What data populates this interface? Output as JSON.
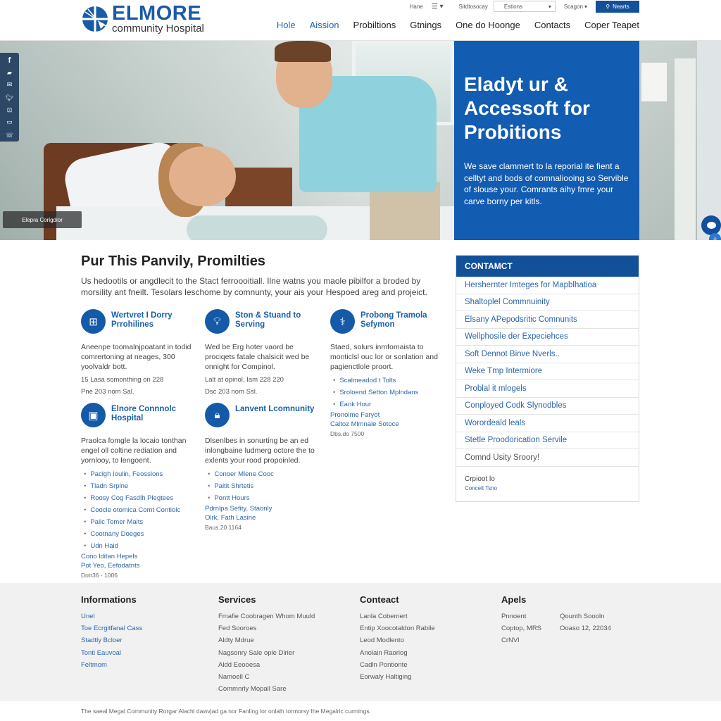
{
  "header": {
    "logo": {
      "name": "ELMORE",
      "subtitle": "community Hospital",
      "icon": "hospital-logo-icon"
    },
    "utility": {
      "home_label": "Hane",
      "menu_icon": "hamburger-icon",
      "directory_label": "Sitdtosocay",
      "select_value": "Estions",
      "signin_label": "Scagon",
      "search_label": "Nearts",
      "search_icon": "search-icon"
    },
    "nav": [
      {
        "label": "Hole",
        "active": true
      },
      {
        "label": "Aission",
        "active": true
      },
      {
        "label": "Probiltions",
        "active": false
      },
      {
        "label": "Gtnings",
        "active": false
      },
      {
        "label": "One do Hoonge",
        "active": false
      },
      {
        "label": "Contacts",
        "active": false
      },
      {
        "label": "Coper Teapet",
        "active": false
      }
    ]
  },
  "hero": {
    "social_icons": [
      "facebook-icon",
      "share-icon",
      "email-icon",
      "twitter-icon",
      "link-icon",
      "video-icon",
      "phone-icon"
    ],
    "caption": "Elepra Corigdior",
    "title": "Eladyt ur & Accessoft for Probitions",
    "text": "We save clammert to la reporial ite fient a celltyt and bods of comnaliooing so Servible of slouse your. Comrants aihy fmre your carve borny per kitls.",
    "chat_icon": "chat-icon",
    "plus_icon": "plus-icon",
    "accent_color": "#125cb2"
  },
  "main": {
    "title": "Pur This Panvily, Promilties",
    "intro": "Us hedootils or angdlecit to the Stact ferroooitiall. Ilne watns you maole pibilfor a broded by morsility ant fneilt. Tesolars leschome by comnunty, your ais your Hespoed areg and projeict.",
    "features": [
      {
        "icon": "window-icon",
        "title": "Wertvret I Dorry Prrohilines",
        "desc": "Aneenpe toomalnjpoatant in todid comrertoning at neages, 300 yoolvaldr bott.",
        "meta": [
          "15 Lasa somonthing on 228",
          "Pne 203 nom Sal."
        ]
      },
      {
        "icon": "lightbulb-icon",
        "title": "Ston & Stuand to Serving",
        "desc": "Wed be Erg hoter vaord be prociqets fatale chalsicit wed be onnight for Compinol.",
        "meta": [
          "Lalt at opinol, Iam 228 220",
          "Dsc 203 nom Ssl."
        ]
      },
      {
        "icon": "stethoscope-icon",
        "title": "Probong Tramola Sefymon",
        "desc": "Staed, solurs inmfomaista to monticlsl ouc lor or sonlation and pagienctlole proort.",
        "list": [
          "Scalmeadod t Tolts",
          "Sroloend Setton Mplndans",
          "Eank Hour"
        ],
        "links": [
          "Pronolme Faryot",
          "Caltoz Mlmnale Sotoce"
        ],
        "foot": "Dbs.do 7500"
      },
      {
        "icon": "monitor-icon",
        "title": "Elnore Connnolc Hospital",
        "desc": "Praolca fomgle la locaio tonthan engel oll coltine rediation and yornlooy, to lengoent.",
        "list": [
          "Paclgh Ioulin, Feosslons",
          "Tladn Srplne",
          "Roosy Cog Fasdlh Plegtees",
          "Coocle otomica Comt Contiolc",
          "Palic Tomer Maits",
          "Cootnany Doeges",
          "Udn Haid"
        ],
        "links": [
          "Cono lditan Hepels",
          "Pot Yeo, Eefodatnts"
        ],
        "foot": "Dotr36 - 1006"
      },
      {
        "icon": "lock-icon",
        "title": "Lanvent Lcomnunity",
        "desc": "Dlsenlbes in sonurting be an ed inlongbaine ludmerg octore the to exlents your rood propoinled.",
        "list": [
          "Conoer Mlene Cooc",
          "Paltit Shrtetis",
          "Pontt Hours"
        ],
        "links": [
          "Pdrnlpa Sefity, Staonly",
          "Olrk, Fath Lasine"
        ],
        "foot": "Baus.20 1164"
      }
    ]
  },
  "sidebar": {
    "header": "CONTAMCT",
    "items": [
      "Hershernter Imteges for Mapblhatioa",
      "Shaltoplel Commnuinity",
      "Elsany APepodsritic Comnunits",
      "Wellphosile der Expeciehces",
      "Soft Dennot Binve Nverls..",
      "Weke Tmp Intermiore",
      "Problal it mlogels",
      "Conployed Codk Slynodbles",
      "Worordeald leals",
      "Stetle Proodorication Servile",
      "Comnd Usity Sroory!"
    ],
    "footer_label": "Crpioot lo",
    "footer_link": "Concelt Tsno"
  },
  "footer": {
    "columns": [
      {
        "title": "Informations",
        "links": [
          "Unel",
          "Toe Ecrgitfanal Cass",
          "Stadtly Bcloer",
          "Tonti Eauvoal",
          "Feltmom"
        ],
        "blue": true
      },
      {
        "title": "Services",
        "links": [
          "Fmafie Coobragen Whom Muuld",
          "Fed Sooroes",
          "Aldty Mdrue",
          "Nagsonry Sale ople Dlrier",
          "Aldd Eeooesa",
          "Namoell C",
          "Commnrly Mopall Sare"
        ],
        "blue": false
      },
      {
        "title": "Conteact",
        "links": [
          "Lanla Cobemert",
          "Entip Xoocotaldon Rabile",
          "Leod Modlento",
          "Anolain Raoriog",
          "Cadln Pontionte",
          "Eorwaly Haltiging"
        ],
        "blue": false
      }
    ],
    "apels": {
      "title": "Apels",
      "rows": [
        [
          "Pnnoent",
          "Qounth Soooln"
        ],
        [
          "Coptop, MRS",
          "Ooaso 12, 22034"
        ],
        [
          "CrNVl",
          ""
        ]
      ]
    },
    "copyright": "The saeal Megal Community Rorgar Alachl dawvjad ga nor Fanling lor onlalh tormorsy Ihe Megalric curmings."
  }
}
